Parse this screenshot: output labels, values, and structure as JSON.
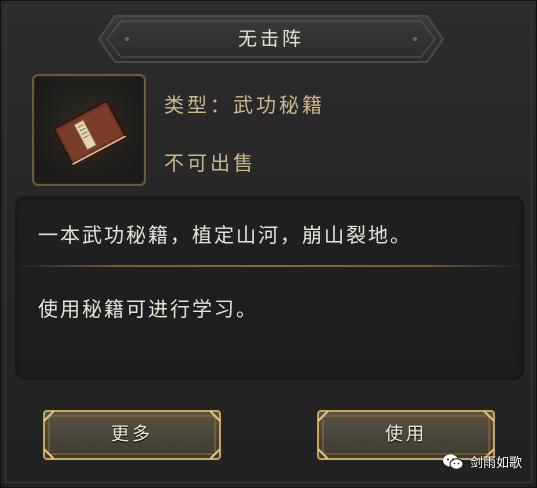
{
  "item": {
    "title": "无击阵",
    "type_line": "类型：武功秘籍",
    "sell_line": "不可出售",
    "icon": "book-icon"
  },
  "description": {
    "flavor": "一本武功秘籍，植定山河，崩山裂地。",
    "usage": "使用秘籍可进行学习。"
  },
  "buttons": {
    "more_label": "更多",
    "use_label": "使用"
  },
  "watermark": {
    "text": "剑雨如歌",
    "icon": "wechat-icon"
  },
  "colors": {
    "gold_accent": "#c7a45a",
    "info_text": "#cdb68a",
    "panel_bg": "#262627"
  }
}
